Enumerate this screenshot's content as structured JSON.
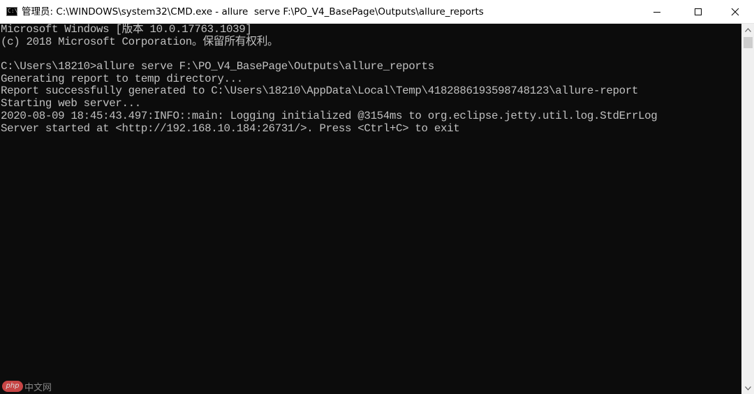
{
  "window": {
    "title": "管理员: C:\\WINDOWS\\system32\\CMD.exe - allure  serve F:\\PO_V4_BasePage\\Outputs\\allure_reports",
    "icon": "cmd-icon",
    "icon_glyph": "C:\\",
    "controls": {
      "minimize": "minimize-icon",
      "maximize": "maximize-icon",
      "close": "close-icon"
    }
  },
  "console": {
    "background": "#0c0c0c",
    "foreground": "#c0c0c0",
    "lines": [
      "Microsoft Windows [版本 10.0.17763.1039]",
      "(c) 2018 Microsoft Corporation。保留所有权利。",
      "",
      "C:\\Users\\18210>allure serve F:\\PO_V4_BasePage\\Outputs\\allure_reports",
      "Generating report to temp directory...",
      "Report successfully generated to C:\\Users\\18210\\AppData\\Local\\Temp\\4182886193598748123\\allure-report",
      "Starting web server...",
      "2020-08-09 18:45:43.497:INFO::main: Logging initialized @3154ms to org.eclipse.jetty.util.log.StdErrLog",
      "Server started at <http://192.168.10.184:26731/>. Press <Ctrl+C> to exit"
    ]
  },
  "scrollbar": {
    "up": "scroll-up-arrow-icon",
    "down": "scroll-down-arrow-icon"
  },
  "watermark": {
    "logo_text": "php",
    "text": "中文网"
  }
}
